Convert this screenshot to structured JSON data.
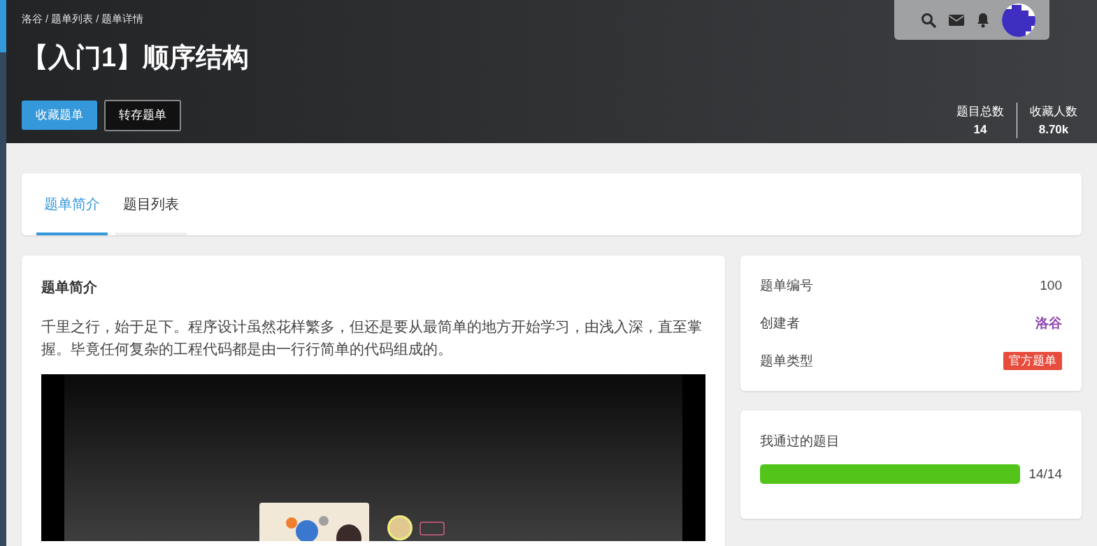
{
  "breadcrumb": [
    "洛谷",
    "题单列表",
    "题单详情"
  ],
  "breadcrumb_separator": "/",
  "title": "【入门1】顺序结构",
  "actions": [
    {
      "label": "收藏题单",
      "kind": "primary"
    },
    {
      "label": "转存题单",
      "kind": "outline"
    }
  ],
  "stats": [
    {
      "label": "题目总数",
      "value": "14"
    },
    {
      "label": "收藏人数",
      "value": "8.70k"
    }
  ],
  "tabs": [
    {
      "label": "题单简介",
      "selected": true
    },
    {
      "label": "题目列表",
      "selected": false
    }
  ],
  "intro": {
    "heading": "题单简介",
    "text": "千里之行，始于足下。程序设计虽然花样繁多，但还是要从最简单的地方开始学习，由浅入深，直至掌握。毕竟任何复杂的工程代码都是由一行行简单的代码组成的。"
  },
  "info": [
    {
      "label": "题单编号",
      "value": "100",
      "kind": "text"
    },
    {
      "label": "创建者",
      "value": "洛谷",
      "kind": "user",
      "color": "#8e44ad"
    },
    {
      "label": "题单类型",
      "value": "官方题单",
      "kind": "tag",
      "color": "#e74c3c"
    }
  ],
  "progress": {
    "title": "我通过的题目",
    "level": 1,
    "reading": "14/14"
  }
}
